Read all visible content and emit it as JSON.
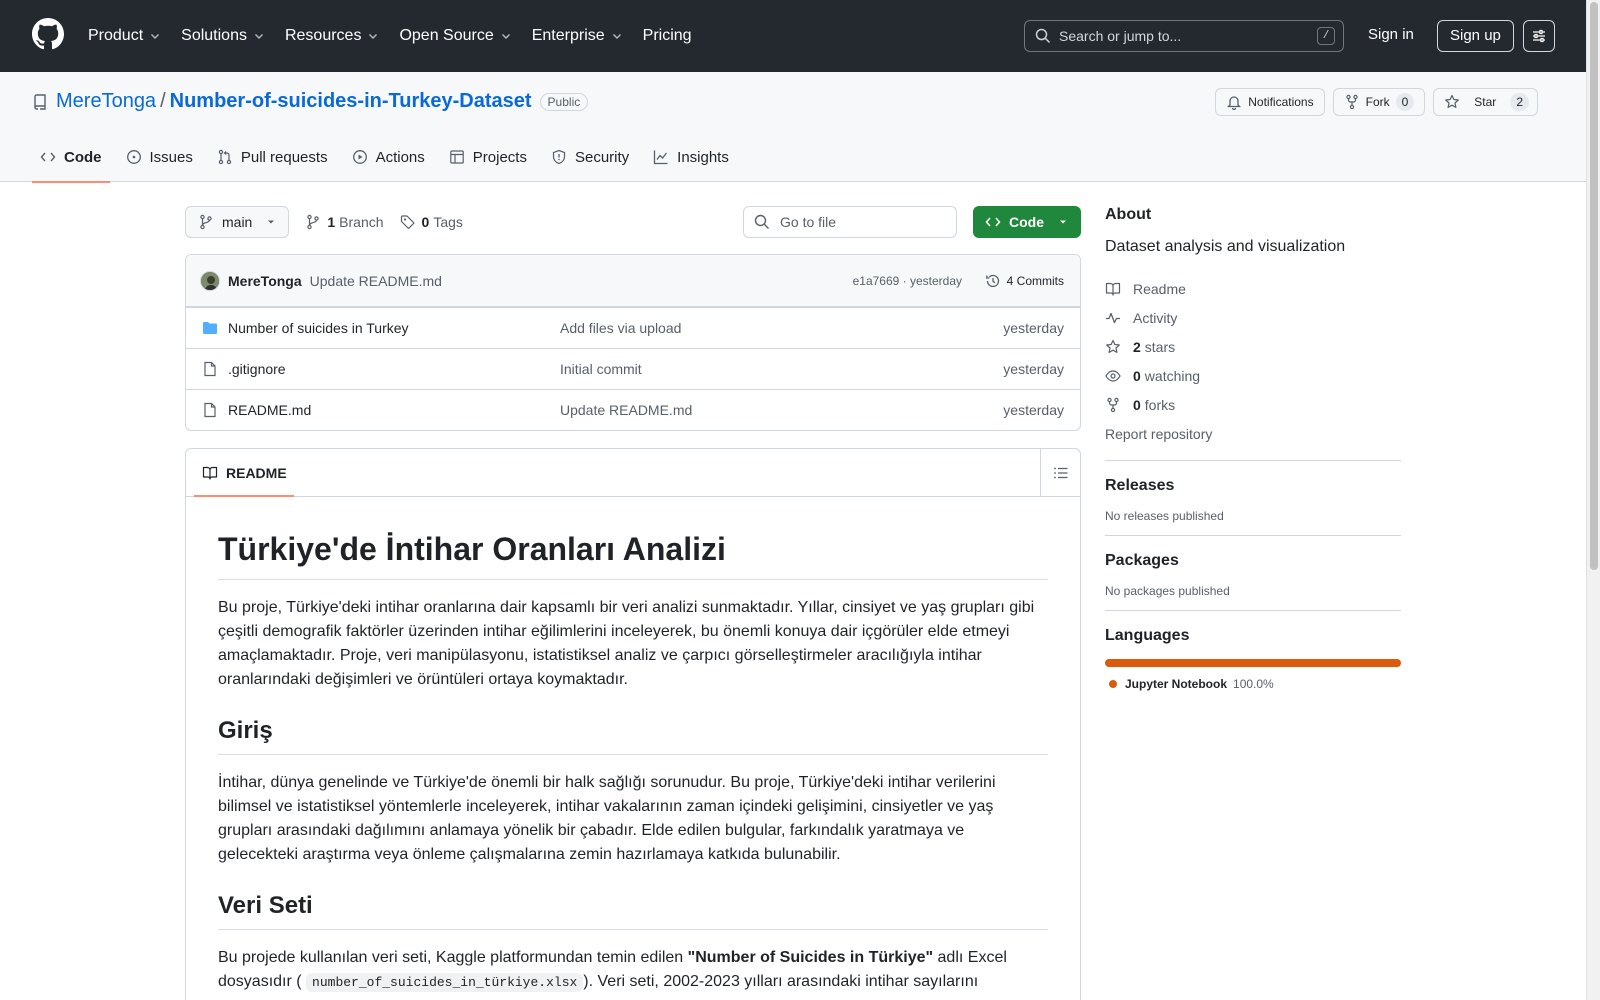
{
  "header": {
    "nav": [
      "Product",
      "Solutions",
      "Resources",
      "Open Source",
      "Enterprise",
      "Pricing"
    ],
    "search_placeholder": "Search or jump to...",
    "search_shortcut": "/",
    "signin": "Sign in",
    "signup": "Sign up"
  },
  "repo": {
    "owner": "MereTonga",
    "separator": "/",
    "name": "Number-of-suicides-in-Turkey-Dataset",
    "visibility": "Public",
    "notifications_label": "Notifications",
    "fork_label": "Fork",
    "fork_count": "0",
    "star_label": "Star",
    "star_count": "2",
    "tabs": [
      "Code",
      "Issues",
      "Pull requests",
      "Actions",
      "Projects",
      "Security",
      "Insights"
    ]
  },
  "toolbar": {
    "branch": "main",
    "branch_count": "1",
    "branch_label": "Branch",
    "tag_count": "0",
    "tag_label": "Tags",
    "goto_placeholder": "Go to file",
    "code_button": "Code"
  },
  "commit": {
    "author": "MereTonga",
    "message": "Update README.md",
    "hash_time": "e1a7669 · yesterday",
    "commits_label": "4 Commits"
  },
  "files": [
    {
      "name": "Number of suicides in Turkey",
      "type": "folder",
      "commit": "Add files via upload",
      "date": "yesterday"
    },
    {
      "name": ".gitignore",
      "type": "file",
      "commit": "Initial commit",
      "date": "yesterday"
    },
    {
      "name": "README.md",
      "type": "file",
      "commit": "Update README.md",
      "date": "yesterday"
    }
  ],
  "readme": {
    "tab_label": "README",
    "h1": "Türkiye'de İntihar Oranları Analizi",
    "p1": "Bu proje, Türkiye'deki intihar oranlarına dair kapsamlı bir veri analizi sunmaktadır. Yıllar, cinsiyet ve yaş grupları gibi çeşitli demografik faktörler üzerinden intihar eğilimlerini inceleyerek, bu önemli konuya dair içgörüler elde etmeyi amaçlamaktadır. Proje, veri manipülasyonu, istatistiksel analiz ve çarpıcı görselleştirmeler aracılığıyla intihar oranlarındaki değişimleri ve örüntüleri ortaya koymaktadır.",
    "h2_intro": "Giriş",
    "p2": "İntihar, dünya genelinde ve Türkiye'de önemli bir halk sağlığı sorunudur. Bu proje, Türkiye'deki intihar verilerini bilimsel ve istatistiksel yöntemlerle inceleyerek, intihar vakalarının zaman içindeki gelişimini, cinsiyetler ve yaş grupları arasındaki dağılımını anlamaya yönelik bir çabadır. Elde edilen bulgular, farkındalık yaratmaya ve gelecekteki araştırma veya önleme çalışmalarına zemin hazırlamaya katkıda bulunabilir.",
    "h2_data": "Veri Seti",
    "p3_start": "Bu projede kullanılan veri seti, Kaggle platformundan temin edilen ",
    "p3_bold": "\"Number of Suicides in Türkiye\"",
    "p3_mid": " adlı Excel dosyasıdır (",
    "p3_code": "number_of_suicides_in_türkiye.xlsx",
    "p3_end": "). Veri seti, 2002-2023 yılları arasındaki intihar sayılarını"
  },
  "sidebar": {
    "about_title": "About",
    "description": "Dataset analysis and visualization",
    "readme_link": "Readme",
    "activity_link": "Activity",
    "stars_count": "2",
    "stars_label": "stars",
    "watching_count": "0",
    "watching_label": "watching",
    "forks_count": "0",
    "forks_label": "forks",
    "report": "Report repository",
    "releases_title": "Releases",
    "releases_text": "No releases published",
    "packages_title": "Packages",
    "packages_text": "No packages published",
    "languages_title": "Languages",
    "language_name": "Jupyter Notebook",
    "language_pct": "100.0%",
    "language_color": "#DA5B0B"
  }
}
